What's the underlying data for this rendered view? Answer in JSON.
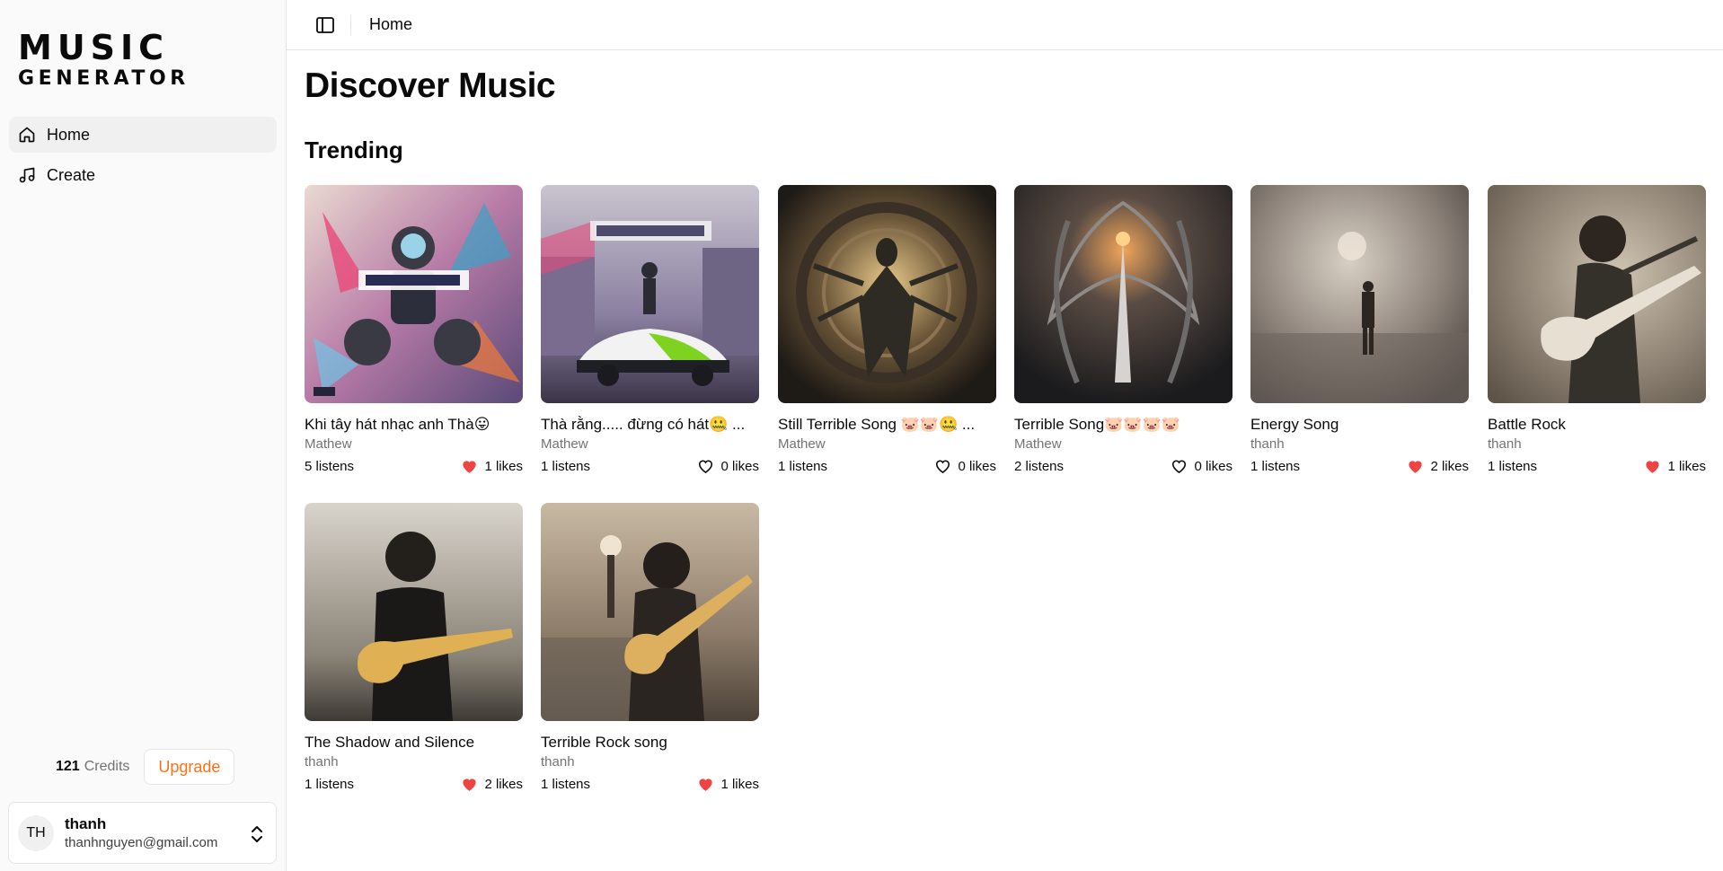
{
  "brand": {
    "line1": "MUSIC",
    "line2": "GENERATOR"
  },
  "nav": [
    {
      "label": "Home",
      "icon": "home-icon",
      "active": true
    },
    {
      "label": "Create",
      "icon": "music-note-icon",
      "active": false
    }
  ],
  "credits": {
    "count": "121",
    "label": "Credits",
    "upgrade_label": "Upgrade"
  },
  "user": {
    "initials": "TH",
    "name": "thanh",
    "email": "thanhnguyen@gmail.com"
  },
  "breadcrumb": "Home",
  "page_title": "Discover Music",
  "section_title": "Trending",
  "colors": {
    "accent": "#f97316",
    "like": "#ef4444",
    "muted": "#737373",
    "border": "#e5e5e5"
  },
  "songs": [
    {
      "title": "Khi tây hát nhạc anh Thà😛",
      "artist": "Mathew",
      "listens": "5 listens",
      "likes": "1 likes",
      "liked": true
    },
    {
      "title": "Thà rằng..... đừng có hát🤐 ...",
      "artist": "Mathew",
      "listens": "1 listens",
      "likes": "0 likes",
      "liked": false
    },
    {
      "title": "Still Terrible Song 🐷🐷🤐 ...",
      "artist": "Mathew",
      "listens": "1 listens",
      "likes": "0 likes",
      "liked": false
    },
    {
      "title": "Terrible Song🐷🐷🐷🐷",
      "artist": "Mathew",
      "listens": "2 listens",
      "likes": "0 likes",
      "liked": false
    },
    {
      "title": "Energy Song",
      "artist": "thanh",
      "listens": "1 listens",
      "likes": "2 likes",
      "liked": true
    },
    {
      "title": "Battle Rock",
      "artist": "thanh",
      "listens": "1 listens",
      "likes": "1 likes",
      "liked": true
    },
    {
      "title": "The Shadow and Silence",
      "artist": "thanh",
      "listens": "1 listens",
      "likes": "2 likes",
      "liked": true
    },
    {
      "title": "Terrible Rock song",
      "artist": "thanh",
      "listens": "1 listens",
      "likes": "1 likes",
      "liked": true
    }
  ]
}
